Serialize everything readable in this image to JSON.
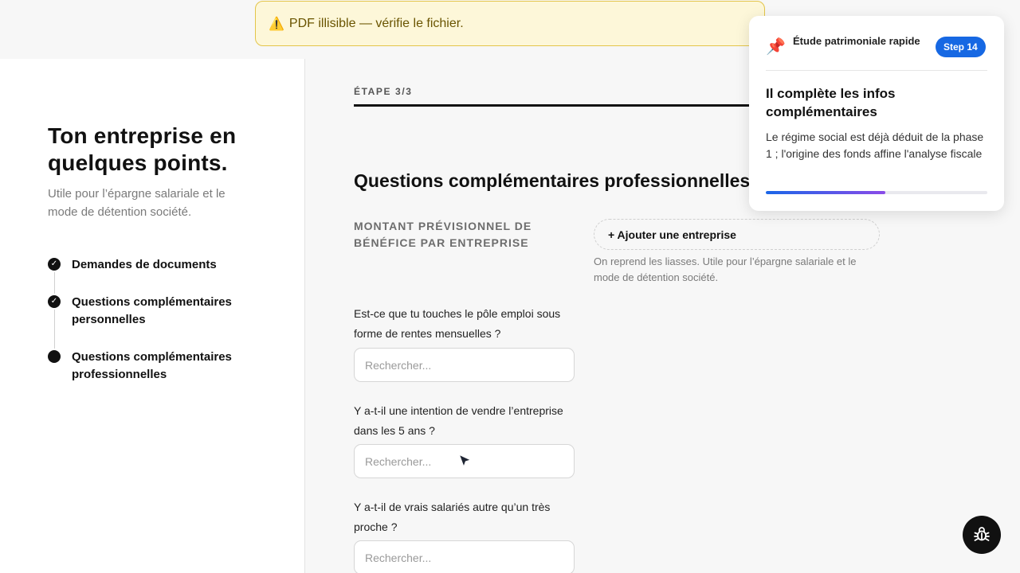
{
  "warning": {
    "icon": "⚠️",
    "text": "PDF illisible — vérifie le fichier."
  },
  "sidebar": {
    "title": "Ton entreprise en quelques points.",
    "subtitle": "Utile pour l’épargne salariale et le mode de détention société.",
    "steps": [
      {
        "label": "Demandes de documents",
        "status": "done"
      },
      {
        "label": "Questions complémentaires personnelles",
        "status": "done"
      },
      {
        "label": "Questions complémentaires professionnelles",
        "status": "current"
      }
    ]
  },
  "main": {
    "step_count": "ÉTAPE 3/3",
    "section_title": "Questions complémentaires professionnelles",
    "profit_question": {
      "label": "MONTANT PRÉVISIONNEL DE BÉNÉFICE PAR ENTREPRISE",
      "button": "+ Ajouter une entreprise",
      "help": "On reprend les liasses. Utile pour l’épargne salariale et le mode de détention société."
    },
    "questions": [
      {
        "label": "Est-ce que tu touches le pôle emploi sous forme de rentes mensuelles ?",
        "placeholder": "Rechercher...",
        "value": ""
      },
      {
        "label": "Y a-t-il une intention de vendre l’entreprise dans les 5 ans ?",
        "placeholder": "Rechercher...",
        "value": ""
      },
      {
        "label": "Y a-t-il de vrais salariés autre qu’un très proche ?",
        "placeholder": "Rechercher...",
        "value": ""
      }
    ]
  },
  "tour": {
    "icon": "📌",
    "name": "Étude patrimoniale rapide",
    "badge": "Step 14",
    "title": "Il complète les infos complémentaires",
    "body": "Le régime social est déjà déduit de la phase 1 ; l'origine des fonds affine l'analyse fiscale",
    "progress": 0.54,
    "progress_colors": [
      "#1a66e8",
      "#8a4be8"
    ]
  },
  "bug_button": {
    "icon": "bug-icon"
  }
}
